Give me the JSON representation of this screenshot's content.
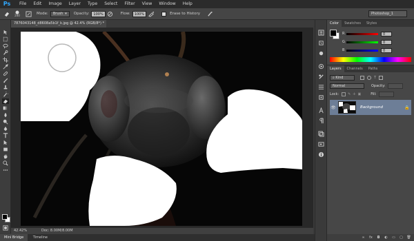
{
  "app": {
    "logo": "Ps"
  },
  "menu": [
    "File",
    "Edit",
    "Image",
    "Layer",
    "Type",
    "Select",
    "Filter",
    "View",
    "Window",
    "Help"
  ],
  "options": {
    "brush_size": "200",
    "mode_label": "Mode:",
    "mode_value": "Brush",
    "opacity_label": "Opacity:",
    "opacity_value": "100%",
    "flow_label": "Flow:",
    "flow_value": "100%",
    "erase_history_label": "Erase to History",
    "workspace": "Photoshop_1"
  },
  "document": {
    "tab_title": "7876043148_d8608a5b1f_k.jpg @ 42.4% (RGB/8*) *",
    "close_glyph": "×"
  },
  "status": {
    "zoom": "42.42%",
    "doc_size": "Doc: 8.00M/8.00M"
  },
  "bottom_tabs": [
    "Mini Bridge",
    "Timeline"
  ],
  "color_panel": {
    "tabs": [
      "Color",
      "Swatches",
      "Styles"
    ],
    "channels": [
      {
        "label": "R",
        "value": "0"
      },
      {
        "label": "G",
        "value": "0"
      },
      {
        "label": "B",
        "value": "0"
      }
    ]
  },
  "layers_panel": {
    "tabs": [
      "Layers",
      "Channels",
      "Paths"
    ],
    "kind_label": "Kind",
    "blend_mode": "Normal",
    "opacity_label": "Opacity:",
    "lock_label": "Lock:",
    "fill_label": "Fill:",
    "layer_name": "Background"
  },
  "colors": {
    "fg": "#000000",
    "bg": "#ffffff",
    "layer_highlight": "#6d7e97"
  }
}
